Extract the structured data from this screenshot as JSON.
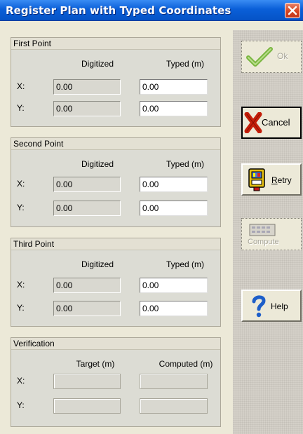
{
  "window": {
    "title": "Register Plan with Typed Coordinates"
  },
  "sections": [
    {
      "title": "First Point",
      "col1": "Digitized",
      "col2": "Typed (m)",
      "rows": [
        {
          "label": "X:",
          "digitized": "0.00",
          "typed": "0.00"
        },
        {
          "label": "Y:",
          "digitized": "0.00",
          "typed": "0.00"
        }
      ]
    },
    {
      "title": "Second Point",
      "col1": "Digitized",
      "col2": "Typed (m)",
      "rows": [
        {
          "label": "X:",
          "digitized": "0.00",
          "typed": "0.00"
        },
        {
          "label": "Y:",
          "digitized": "0.00",
          "typed": "0.00"
        }
      ]
    },
    {
      "title": "Third Point",
      "col1": "Digitized",
      "col2": "Typed (m)",
      "rows": [
        {
          "label": "X:",
          "digitized": "0.00",
          "typed": "0.00"
        },
        {
          "label": "Y:",
          "digitized": "0.00",
          "typed": "0.00"
        }
      ]
    },
    {
      "title": "Verification",
      "col1": "Target (m)",
      "col2": "Computed (m)",
      "rows": [
        {
          "label": "X:",
          "target": "",
          "computed": ""
        },
        {
          "label": "Y:",
          "target": "",
          "computed": ""
        }
      ]
    }
  ],
  "buttons": {
    "ok": {
      "label": "Ok",
      "icon": "checkmark-icon",
      "enabled": false
    },
    "cancel": {
      "label": "Cancel",
      "icon": "x-icon",
      "enabled": true
    },
    "retry": {
      "label": "Retry",
      "icon": "device-icon",
      "enabled": true
    },
    "compute": {
      "label": "Compute",
      "icon": "calculator-icon",
      "enabled": false
    },
    "help": {
      "label": "Help",
      "icon": "question-icon",
      "enabled": true
    }
  },
  "colors": {
    "title_bar": "#0a5fd8",
    "cancel_x": "#c41e0a",
    "ok_check": "#7ab640",
    "help_q": "#1d5ec9"
  }
}
